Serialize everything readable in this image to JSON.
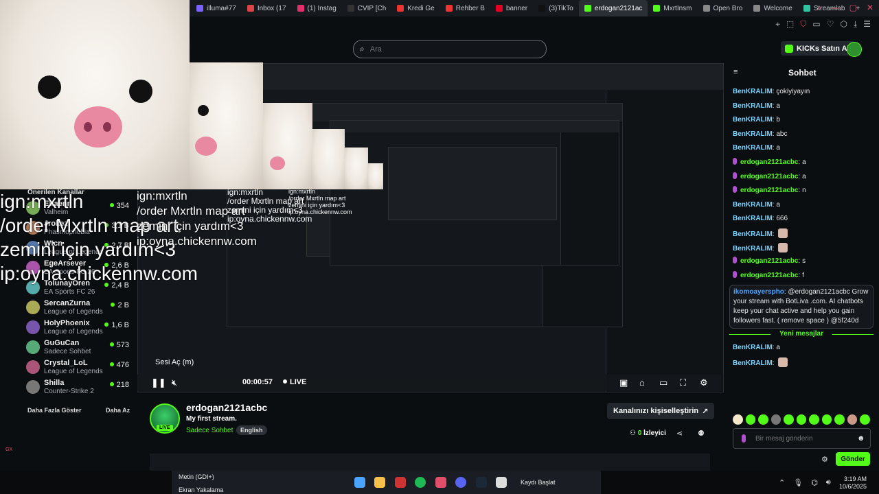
{
  "browser": {
    "tabs": [
      {
        "label": "illuma#77",
        "color": "#7b61ff"
      },
      {
        "label": "Inbox (17",
        "color": "#d44"
      },
      {
        "label": "(1) Instag",
        "color": "#e1306c"
      },
      {
        "label": "CVIP [Ch",
        "color": "#333"
      },
      {
        "label": "Kredi Ge",
        "color": "#e33"
      },
      {
        "label": "Rehber B",
        "color": "#e33"
      },
      {
        "label": "banner",
        "color": "#e60023"
      },
      {
        "label": "(3)TikTo",
        "color": "#111"
      },
      {
        "label": "erdogan2121ac",
        "color": "#53fc18",
        "active": true
      },
      {
        "label": "MxrtInsm",
        "color": "#53fc18"
      },
      {
        "label": "Open Bro",
        "color": "#888"
      },
      {
        "label": "Welcome",
        "color": "#888"
      },
      {
        "label": "Streamlab",
        "color": "#31c3a2"
      }
    ],
    "new_tab": "+"
  },
  "header": {
    "search_placeholder": "Ara",
    "kicks_button": "KICKs Satın Al"
  },
  "overlay": {
    "big": "ign:mxrtln\n/order Mxrtln map art\nzemini için yardım<3\nip:oyna.chickennw.com",
    "mid": "ign:mxrtln\n/order Mxrtln map art\nzemini için yardım<3\nip:oyna.chickennw.com",
    "small": "ign:mxrtln\n/order Mxrtln map art\nzemini için yardım<3\nip:oyna.chickennw.com",
    "xsmall": "ign:mxrtln\n/order Mxrtln map art\nzemini için yardım<3\nip:oyna.chickennw.com"
  },
  "sidebar": {
    "title": "Önerilen Kanallar",
    "channels": [
      {
        "name": "Elraenn",
        "category": "Valheim",
        "viewers": "354"
      },
      {
        "name": "Jrokez",
        "category": "Phasmophobia",
        "viewers": "3,1 B"
      },
      {
        "name": "Wtcn",
        "category": "League of Legends",
        "viewers": "2,7 B"
      },
      {
        "name": "EgeArsever",
        "category": "EA Sports FC 26",
        "viewers": "2,6 B"
      },
      {
        "name": "TolunayOren",
        "category": "EA Sports FC 26",
        "viewers": "2,4 B"
      },
      {
        "name": "SercanZurna",
        "category": "League of Legends",
        "viewers": "2 B"
      },
      {
        "name": "HolyPhoenix",
        "category": "League of Legends",
        "viewers": "1,6 B"
      },
      {
        "name": "GuGuCan",
        "category": "Sadece Sohbet",
        "viewers": "573"
      },
      {
        "name": "Crystal_LoL",
        "category": "League of Legends",
        "viewers": "476"
      },
      {
        "name": "Shilla",
        "category": "Counter-Strike 2",
        "viewers": "218"
      }
    ],
    "show_more": "Daha Fazla Göster",
    "show_less": "Daha Az"
  },
  "player": {
    "tooltip": "Sesi Aç (m)",
    "time": "00:00:57",
    "live": "LIVE"
  },
  "stream": {
    "name": "erdogan2121acbc",
    "title": "My first stream.",
    "category": "Sadece Sohbet",
    "tag": "English",
    "customize": "Kanalınızı kişiselleştirin",
    "viewer_count": "0",
    "viewer_label": "İzleyici",
    "live_badge": "LIVE"
  },
  "chat": {
    "title": "Sohbet",
    "messages": [
      {
        "user": "BenKRALIM",
        "text": "çokiyiyayın",
        "color": "#7fd3ff"
      },
      {
        "user": "BenKRALIM",
        "text": "a",
        "color": "#7fd3ff"
      },
      {
        "user": "BenKRALIM",
        "text": "b",
        "color": "#7fd3ff"
      },
      {
        "user": "BenKRALIM",
        "text": "abc",
        "color": "#7fd3ff"
      },
      {
        "user": "BenKRALIM",
        "text": "a",
        "color": "#7fd3ff"
      },
      {
        "user": "erdogan2121acbc",
        "text": "a",
        "color": "#53fc18",
        "badge": true
      },
      {
        "user": "erdogan2121acbc",
        "text": "a",
        "color": "#53fc18",
        "badge": true
      },
      {
        "user": "erdogan2121acbc",
        "text": "n",
        "color": "#53fc18",
        "badge": true
      },
      {
        "user": "BenKRALIM",
        "text": "a",
        "color": "#7fd3ff"
      },
      {
        "user": "BenKRALIM",
        "text": "666",
        "color": "#7fd3ff"
      },
      {
        "user": "BenKRALIM",
        "text": "",
        "color": "#7fd3ff",
        "emote": true
      },
      {
        "user": "BenKRALIM",
        "text": "",
        "color": "#7fd3ff",
        "emote": true
      },
      {
        "user": "erdogan2121acbc",
        "text": "s",
        "color": "#53fc18",
        "badge": true
      },
      {
        "user": "erdogan2121acbc",
        "text": "f",
        "color": "#53fc18",
        "badge": true
      }
    ],
    "bot_user": "ikomoayerspho",
    "bot_text": "@erdogan2121acbc Grow your stream with BotLiva .com. AI chatbots keep your chat active and help you gain followers fast. ( remove space ) @5f240d",
    "new_messages": "Yeni mesajlar",
    "after": [
      {
        "user": "BenKRALIM",
        "text": "a",
        "color": "#7fd3ff"
      },
      {
        "user": "BenKRALIM",
        "text": "",
        "color": "#7fd3ff",
        "emote": true
      }
    ],
    "input_placeholder": "Bir mesaj gönderin",
    "send": "Gönder"
  },
  "taskbar": {
    "obs_sources": [
      {
        "label": "Metin (GDI+)"
      },
      {
        "label": "Ekran Yakalama"
      }
    ],
    "record_label": "Kaydı Başlat",
    "time": "3:19 AM",
    "date": "10/6/2025"
  }
}
